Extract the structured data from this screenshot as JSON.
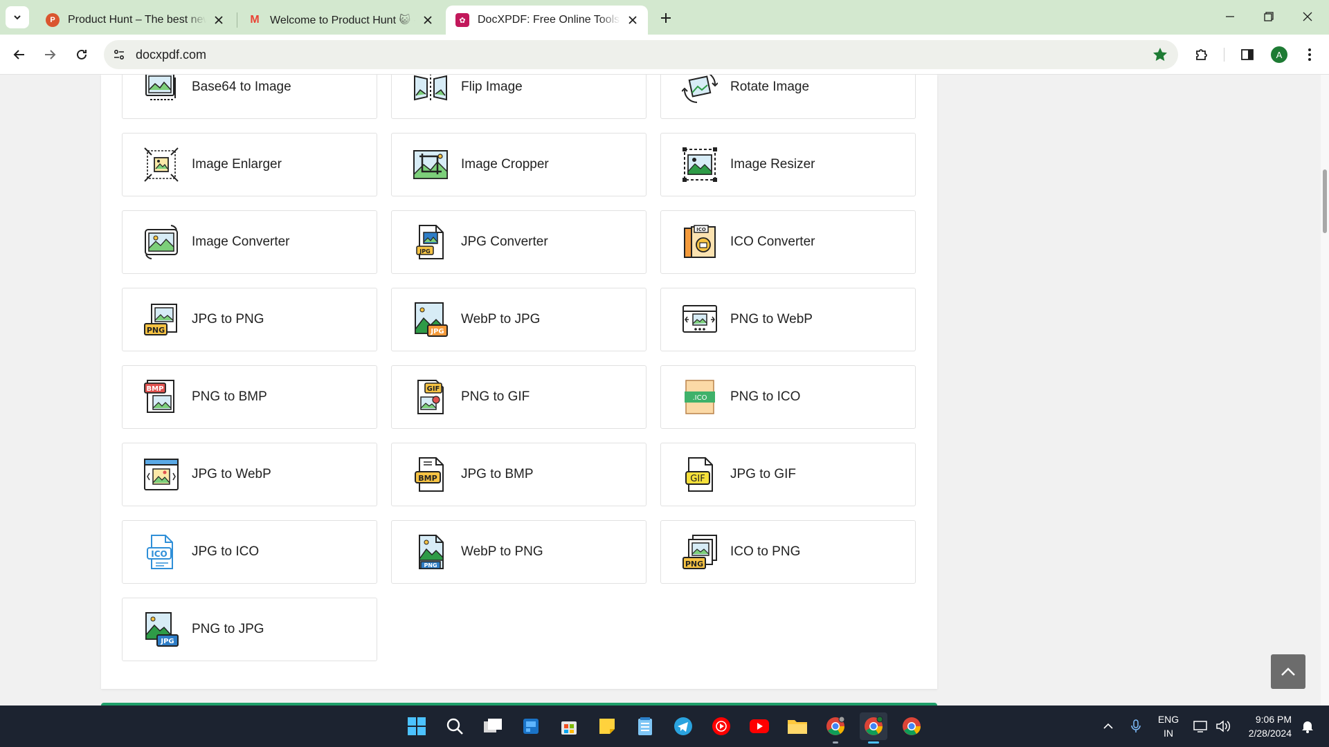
{
  "browser": {
    "tabs": [
      {
        "title": "Product Hunt – The best new products in tech",
        "favicon": "P",
        "color": "#da552f"
      },
      {
        "title": "Welcome to Product Hunt 😺 - Gmail",
        "favicon": "M",
        "color": "#ea4335"
      },
      {
        "title": "DocXPDF: Free Online Tools • Free",
        "favicon": "✿",
        "color": "#c2185b"
      }
    ],
    "url": "docxpdf.com",
    "profile_initial": "A"
  },
  "tools": [
    {
      "label": "Base64 to Image",
      "icon": "base64-icon"
    },
    {
      "label": "Flip Image",
      "icon": "flip-icon"
    },
    {
      "label": "Rotate Image",
      "icon": "rotate-icon"
    },
    {
      "label": "Image Enlarger",
      "icon": "enlarge-icon"
    },
    {
      "label": "Image Cropper",
      "icon": "crop-icon"
    },
    {
      "label": "Image Resizer",
      "icon": "resize-icon"
    },
    {
      "label": "Image Converter",
      "icon": "convert-icon"
    },
    {
      "label": "JPG Converter",
      "icon": "jpg-file-icon"
    },
    {
      "label": "ICO Converter",
      "icon": "ico-file-icon"
    },
    {
      "label": "JPG to PNG",
      "icon": "png-badge-icon"
    },
    {
      "label": "WebP to JPG",
      "icon": "jpg-badge-icon"
    },
    {
      "label": "PNG to WebP",
      "icon": "webp-icon"
    },
    {
      "label": "PNG to BMP",
      "icon": "bmp-icon"
    },
    {
      "label": "PNG to GIF",
      "icon": "gif-icon"
    },
    {
      "label": "PNG to ICO",
      "icon": "ico-icon"
    },
    {
      "label": "JPG to WebP",
      "icon": "webp-window-icon"
    },
    {
      "label": "JPG to BMP",
      "icon": "bmp-file-icon"
    },
    {
      "label": "JPG to GIF",
      "icon": "gif-file-icon"
    },
    {
      "label": "JPG to ICO",
      "icon": "ico-doc-icon"
    },
    {
      "label": "WebP to PNG",
      "icon": "png-doc-icon"
    },
    {
      "label": "ICO to PNG",
      "icon": "png-stack-icon"
    },
    {
      "label": "PNG to JPG",
      "icon": "jpg-picture-icon"
    }
  ],
  "taskbar": {
    "lang_top": "ENG",
    "lang_bottom": "IN",
    "time": "9:06 PM",
    "date": "2/28/2024"
  }
}
